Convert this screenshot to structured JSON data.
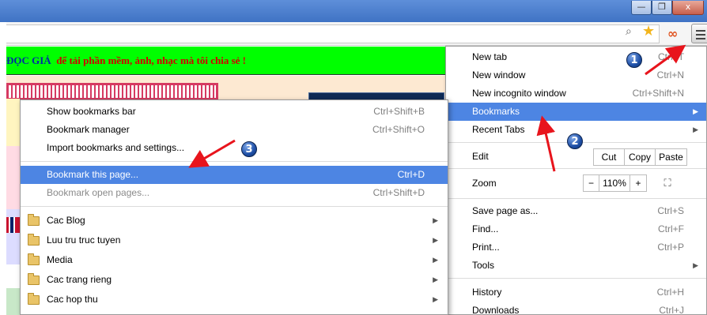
{
  "window": {
    "minimize_icon": "—",
    "restore_icon": "❐",
    "close_icon": "x"
  },
  "page": {
    "banner_part1": "ĐỌC GIẢ",
    "banner_part2": "để tải phần mềm, ảnh, nhạc mà tôi chia sẻ !"
  },
  "chrome_menu": {
    "items": [
      {
        "label": "New tab",
        "shortcut": "Ctrl+T"
      },
      {
        "label": "New window",
        "shortcut": "Ctrl+N"
      },
      {
        "label": "New incognito window",
        "shortcut": "Ctrl+Shift+N"
      },
      {
        "label": "Bookmarks",
        "shortcut": ""
      },
      {
        "label": "Recent Tabs",
        "shortcut": ""
      }
    ],
    "edit": {
      "label": "Edit",
      "cut": "Cut",
      "copy": "Copy",
      "paste": "Paste"
    },
    "zoom": {
      "label": "Zoom",
      "minus": "−",
      "value": "110%",
      "plus": "+"
    },
    "items2": [
      {
        "label": "Save page as...",
        "shortcut": "Ctrl+S"
      },
      {
        "label": "Find...",
        "shortcut": "Ctrl+F"
      },
      {
        "label": "Print...",
        "shortcut": "Ctrl+P"
      },
      {
        "label": "Tools",
        "shortcut": ""
      },
      {
        "label": "History",
        "shortcut": "Ctrl+H"
      },
      {
        "label": "Downloads",
        "shortcut": "Ctrl+J"
      }
    ]
  },
  "bookmarks_menu": {
    "items": [
      {
        "label": "Show bookmarks bar",
        "shortcut": "Ctrl+Shift+B"
      },
      {
        "label": "Bookmark manager",
        "shortcut": "Ctrl+Shift+O"
      },
      {
        "label": "Import bookmarks and settings...",
        "shortcut": ""
      },
      {
        "label": "Bookmark this page...",
        "shortcut": "Ctrl+D"
      },
      {
        "label": "Bookmark open pages...",
        "shortcut": "Ctrl+Shift+D"
      }
    ],
    "folders": [
      "Cac Blog",
      "Luu tru truc tuyen",
      "Media",
      "Cac trang rieng",
      "Cac hop thu"
    ]
  },
  "annotations": {
    "badge1": "1",
    "badge2": "2",
    "badge3": "3",
    "arrow_color": "#e8141c"
  }
}
